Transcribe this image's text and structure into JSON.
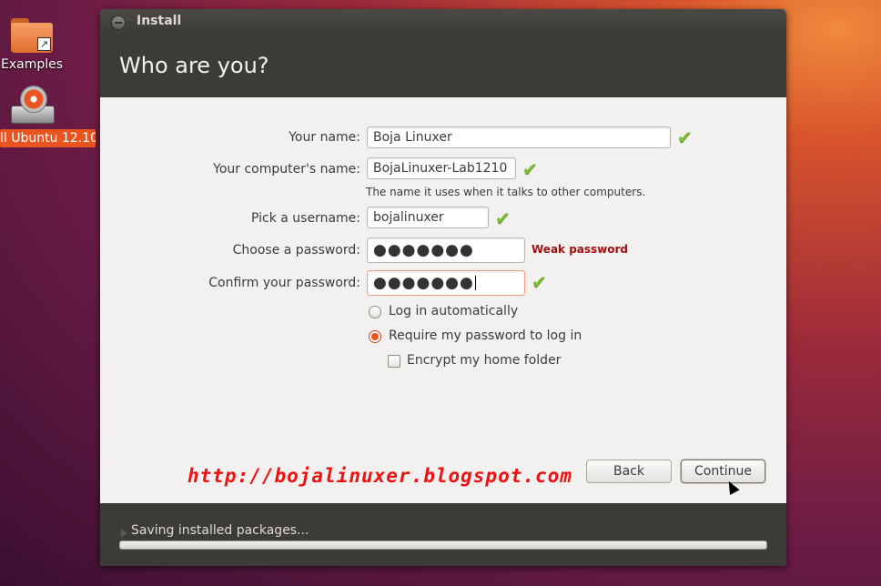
{
  "desktop": {
    "icons": [
      {
        "label": "Examples",
        "icon": "folder-icon"
      },
      {
        "label": "ll Ubuntu 12.10",
        "icon": "installer-icon"
      }
    ]
  },
  "window": {
    "title": "Install",
    "heading": "Who are you?"
  },
  "form": {
    "name_label": "Your name:",
    "name_value": "Boja Linuxer",
    "computer_label": "Your computer's name:",
    "computer_value": "BojaLinuxer-Lab1210",
    "computer_hint": "The name it uses when it talks to other computers.",
    "username_label": "Pick a username:",
    "username_value": "bojalinuxer",
    "password_label": "Choose a password:",
    "password_value": "●●●●●●●",
    "password_strength": "Weak password",
    "confirm_label": "Confirm your password:",
    "confirm_value": "●●●●●●●",
    "login_auto_label": "Log in automatically",
    "require_password_label": "Require my password to log in",
    "encrypt_label": "Encrypt my home folder",
    "selected_login_option": "Require my password to log in",
    "encrypt_checked": false,
    "check_color": "#7dbb36"
  },
  "watermark": "http://bojalinuxer.blogspot.com",
  "buttons": {
    "back": "Back",
    "continue": "Continue"
  },
  "footer": {
    "status": "Saving installed packages...",
    "progress": 0
  },
  "colors": {
    "accent": "#e95420",
    "header_bg": "#3c3b37",
    "weak_password": "#a01010",
    "watermark": "#ee1111"
  }
}
